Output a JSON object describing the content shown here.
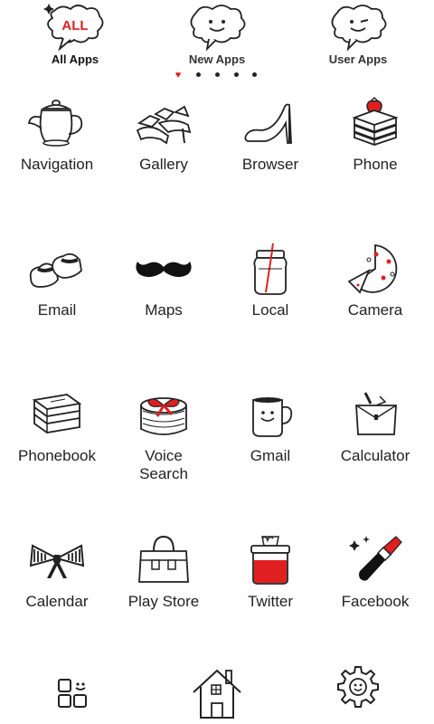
{
  "tabs": [
    {
      "label": "All Apps",
      "bubble_text": "ALL",
      "active": true
    },
    {
      "label": "New Apps",
      "active": false
    },
    {
      "label": "User Apps",
      "active": false
    }
  ],
  "page_indicator": {
    "count": 5,
    "current": 1
  },
  "apps": [
    {
      "label": "Navigation",
      "icon": "teapot-icon"
    },
    {
      "label": "Gallery",
      "icon": "sandals-icon"
    },
    {
      "label": "Browser",
      "icon": "high-heel-icon"
    },
    {
      "label": "Phone",
      "icon": "strawberry-cake-icon"
    },
    {
      "label": "Email",
      "icon": "shoes-icon"
    },
    {
      "label": "Maps",
      "icon": "mustache-icon"
    },
    {
      "label": "Local",
      "icon": "mason-jar-icon"
    },
    {
      "label": "Camera",
      "icon": "pizza-icon"
    },
    {
      "label": "Phonebook",
      "icon": "books-icon"
    },
    {
      "label": "Voice\nSearch",
      "icon": "gift-box-icon"
    },
    {
      "label": "Gmail",
      "icon": "mug-icon"
    },
    {
      "label": "Calculator",
      "icon": "pouch-icon"
    },
    {
      "label": "Calendar",
      "icon": "bow-icon"
    },
    {
      "label": "Play Store",
      "icon": "handbag-icon"
    },
    {
      "label": "Twitter",
      "icon": "jam-jar-icon"
    },
    {
      "label": "Facebook",
      "icon": "lipstick-icon"
    }
  ],
  "dock": [
    {
      "icon": "app-grid-icon"
    },
    {
      "icon": "house-icon"
    },
    {
      "icon": "settings-gear-icon"
    }
  ],
  "colors": {
    "accent": "#e02020",
    "ink": "#222222",
    "background": "#ffffff"
  }
}
